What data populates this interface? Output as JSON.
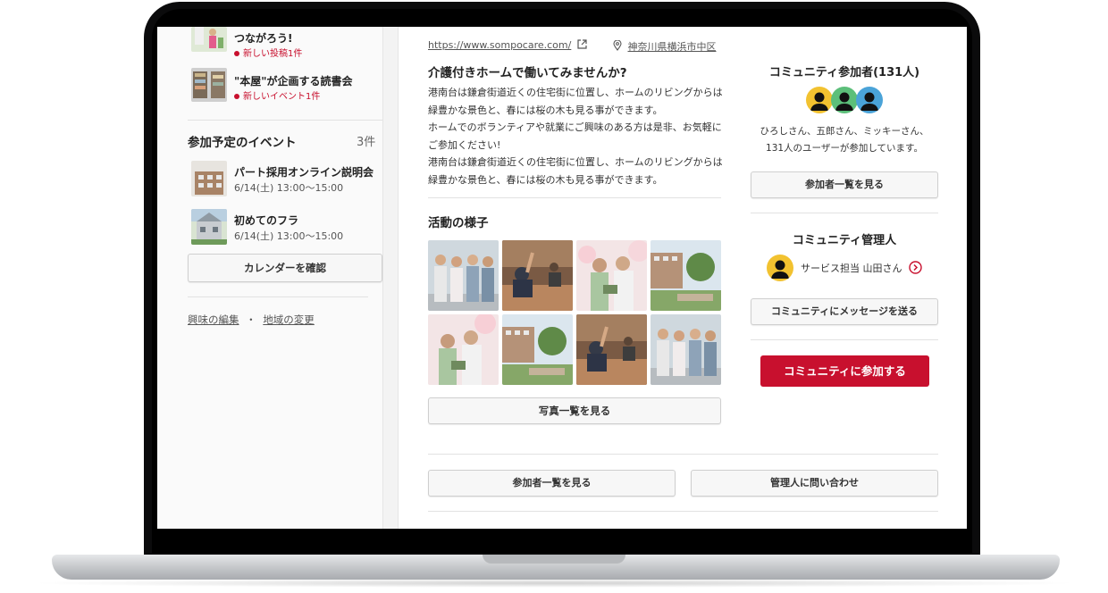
{
  "sidebar": {
    "groups": [
      {
        "title": "つながろう!",
        "note": "新しい投稿1件"
      },
      {
        "title": "\"本屋\"が企画する読書会",
        "note": "新しいイベント1件"
      }
    ],
    "events_heading": "参加予定のイベント",
    "events_count": "3件",
    "events": [
      {
        "title": "パート採用オンライン説明会",
        "date": "6/14(土) 13:00〜15:00"
      },
      {
        "title": "初めてのフラ",
        "date": "6/14(土) 13:00〜15:00"
      }
    ],
    "calendar_button": "カレンダーを確認",
    "edit_interests": "興味の編集",
    "separator": "・",
    "change_region": "地域の変更"
  },
  "main": {
    "url": "https://www.sompocare.com/",
    "location": "神奈川県横浜市中区",
    "headline": "介護付きホームで働いてみませんか?",
    "body_lines": [
      "港南台は鎌倉街道近くの住宅街に位置し、ホームのリビングからは",
      "緑豊かな景色と、春には桜の木も見る事ができます。",
      "ホームでのボランティアや就業にご興味のある方は是非、お気軽に",
      "ご参加ください!",
      "港南台は鎌倉街道近くの住宅街に位置し、ホームのリビングからは",
      "緑豊かな景色と、春には桜の木も見る事ができます。"
    ],
    "activity_heading": "活動の様子",
    "photos_button": "写真一覧を見る",
    "bottom_members_button": "参加者一覧を見る",
    "bottom_contact_button": "管理人に問い合わせ"
  },
  "side": {
    "members_heading": "コミュニティ参加者(131人)",
    "members_line1": "ひろしさん、五郎さん、ミッキーさん、",
    "members_line2": "131人のユーザーが参加しています。",
    "members_button": "参加者一覧を見る",
    "admin_heading": "コミュニティ管理人",
    "admin_name": "サービス担当 山田さん",
    "message_button": "コミュニティにメッセージを送る",
    "join_button": "コミュニティに参加する"
  },
  "colors": {
    "accent": "#c8102e",
    "avatar_yellow": "#f2c230",
    "avatar_green": "#5cbf7a",
    "avatar_blue": "#4aa3d8"
  }
}
